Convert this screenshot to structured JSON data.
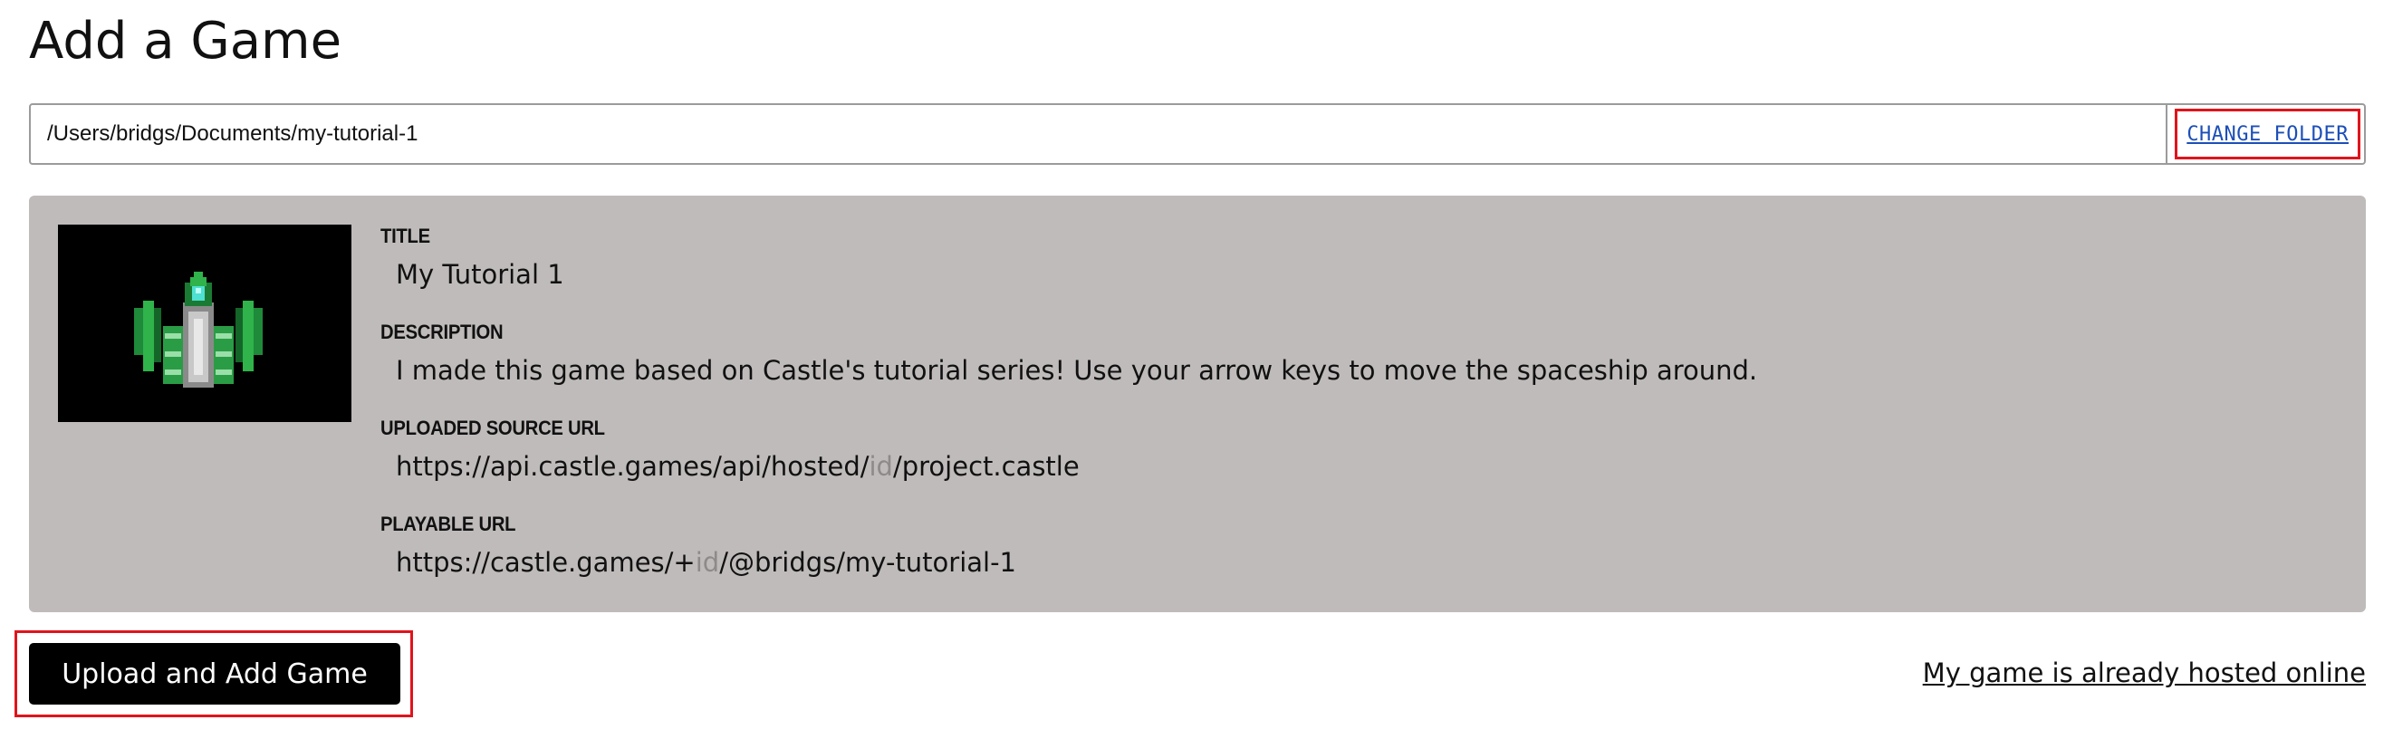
{
  "page": {
    "title": "Add a Game"
  },
  "folder": {
    "path": "/Users/bridgs/Documents/my-tutorial-1",
    "change_label": "CHANGE FOLDER"
  },
  "game": {
    "thumbnail_icon": "spaceship-icon",
    "title_label": "TITLE",
    "title_value": "My Tutorial 1",
    "description_label": "DESCRIPTION",
    "description_value": "I made this game based on Castle's tutorial series! Use your arrow keys to move the spaceship around.",
    "source_url_label": "UPLOADED SOURCE URL",
    "source_url_prefix": "https://api.castle.games/api/hosted/",
    "source_url_placeholder": "id",
    "source_url_suffix": "/project.castle",
    "playable_url_label": "PLAYABLE URL",
    "playable_url_prefix": "https://castle.games/+",
    "playable_url_placeholder": "id",
    "playable_url_suffix": "/@bridgs/my-tutorial-1"
  },
  "actions": {
    "upload_label": "Upload and Add Game",
    "hosted_label": "My game is already hosted online"
  },
  "colors": {
    "panel_background": "#c0bbbb",
    "highlight": "#e0141c",
    "link": "#1c4fb8",
    "button_background": "#000000"
  }
}
